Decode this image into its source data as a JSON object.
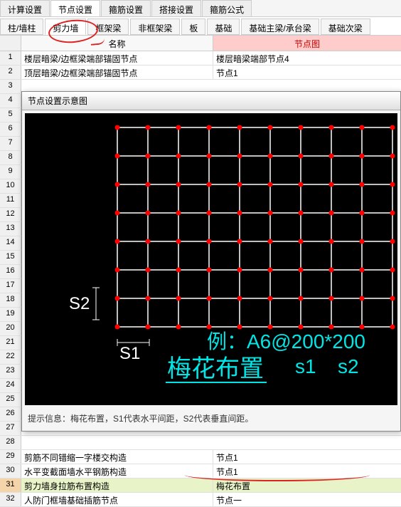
{
  "tabs1": {
    "items": [
      "计算设置",
      "节点设置",
      "箍筋设置",
      "搭接设置",
      "箍筋公式"
    ],
    "active": 1
  },
  "tabs2": {
    "items": [
      "柱/墙柱",
      "剪力墙",
      "框架梁",
      "非框架梁",
      "板",
      "基础",
      "基础主梁/承台梁",
      "基础次梁"
    ],
    "active": 1
  },
  "grid": {
    "header": {
      "col1": "名称",
      "col2": "节点图"
    },
    "rows": [
      {
        "num": 1,
        "name": "楼层暗梁/边框梁端部锚固节点",
        "img": "楼层暗梁端部节点4"
      },
      {
        "num": 2,
        "name": "顶层暗梁/边框梁端部锚固节点",
        "img": "节点1"
      }
    ],
    "emptyRows": [
      3,
      4,
      5,
      6,
      7,
      8,
      9,
      10,
      11,
      12,
      13,
      14,
      15,
      16,
      17,
      18,
      19,
      20,
      21,
      22,
      23,
      24,
      25,
      26,
      27,
      28
    ],
    "bottomRows": [
      {
        "num": 29,
        "name": "剪筋不同错缩一字楼交构造",
        "img": "节点1",
        "highlight": false
      },
      {
        "num": 30,
        "name": "水平变截面墙水平钢筋构造",
        "img": "节点1",
        "highlight": false
      },
      {
        "num": 31,
        "name": "剪力墙身拉筋布置构造",
        "img": "梅花布置",
        "highlight": true
      },
      {
        "num": 32,
        "name": "人防门框墙基础插筋节点",
        "img": "节点一",
        "highlight": false
      }
    ]
  },
  "diagram": {
    "title": "节点设置示意图",
    "hint": "提示信息：梅花布置，S1代表水平间距，S2代表垂直间距。",
    "labels": {
      "s1": "S1",
      "s2": "S2",
      "example": "例：A6@200*200",
      "s1_lower": "s1",
      "s2_lower": "s2",
      "title_text": "梅花布置"
    }
  }
}
